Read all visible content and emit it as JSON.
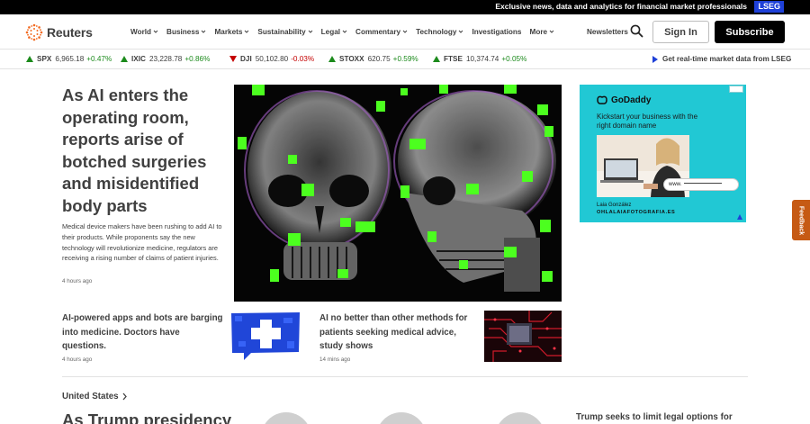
{
  "topbar": {
    "promo": "Exclusive news, data and analytics for financial market professionals",
    "badge": "LSEG"
  },
  "nav": {
    "logo": "Reuters",
    "items": [
      {
        "label": "World",
        "dropdown": true
      },
      {
        "label": "Business",
        "dropdown": true
      },
      {
        "label": "Markets",
        "dropdown": true
      },
      {
        "label": "Sustainability",
        "dropdown": true
      },
      {
        "label": "Legal",
        "dropdown": true
      },
      {
        "label": "Commentary",
        "dropdown": true
      },
      {
        "label": "Technology",
        "dropdown": true
      },
      {
        "label": "Investigations",
        "dropdown": false
      },
      {
        "label": "More",
        "dropdown": true
      }
    ],
    "newsletters": "Newsletters",
    "sign_in": "Sign In",
    "subscribe": "Subscribe"
  },
  "ticker": {
    "items": [
      {
        "symbol": "SPX",
        "value": "6,965.18",
        "change": "+0.47%",
        "direction": "up"
      },
      {
        "symbol": "IXIC",
        "value": "23,228.78",
        "change": "+0.86%",
        "direction": "up"
      },
      {
        "symbol": "DJI",
        "value": "50,102.80",
        "change": "-0.03%",
        "direction": "down"
      },
      {
        "symbol": "STOXX",
        "value": "620.75",
        "change": "+0.59%",
        "direction": "up"
      },
      {
        "symbol": "FTSE",
        "value": "10,374.74",
        "change": "+0.05%",
        "direction": "up"
      }
    ],
    "lseg_link": "Get real-time market data from LSEG"
  },
  "lead": {
    "headline": "As AI enters the operating room, reports arise of botched surgeries and misidentified body parts",
    "summary": "Medical device makers have been rushing to add AI to their products. While proponents say the new technology will revolutionize medicine, regulators are receiving a rising number of claims of patient injuries.",
    "time": "4 hours ago"
  },
  "secondary": [
    {
      "headline": "AI-powered apps and bots are barging into medicine. Doctors have questions.",
      "time": "4 hours ago"
    },
    {
      "headline": "AI no better than other methods for patients seeking medical advice, study shows",
      "time": "14 mins ago"
    }
  ],
  "ad": {
    "brand": "GoDaddy",
    "tagline": "Kickstart your business with the right domain name",
    "url_prefix": "www.",
    "credit_name": "Laia González",
    "credit_site": "OHLALAIAFOTOGRAFIA.ES"
  },
  "feedback": "Feedback",
  "section": {
    "title": "United States",
    "headline": "As Trump presidency",
    "right_headline": "Trump seeks to limit legal options for"
  },
  "colors": {
    "accent_blue": "#1e40d8",
    "up": "#1b8a1b",
    "down": "#c40000",
    "ad_bg": "#21c8d4",
    "feedback": "#c65a14"
  }
}
